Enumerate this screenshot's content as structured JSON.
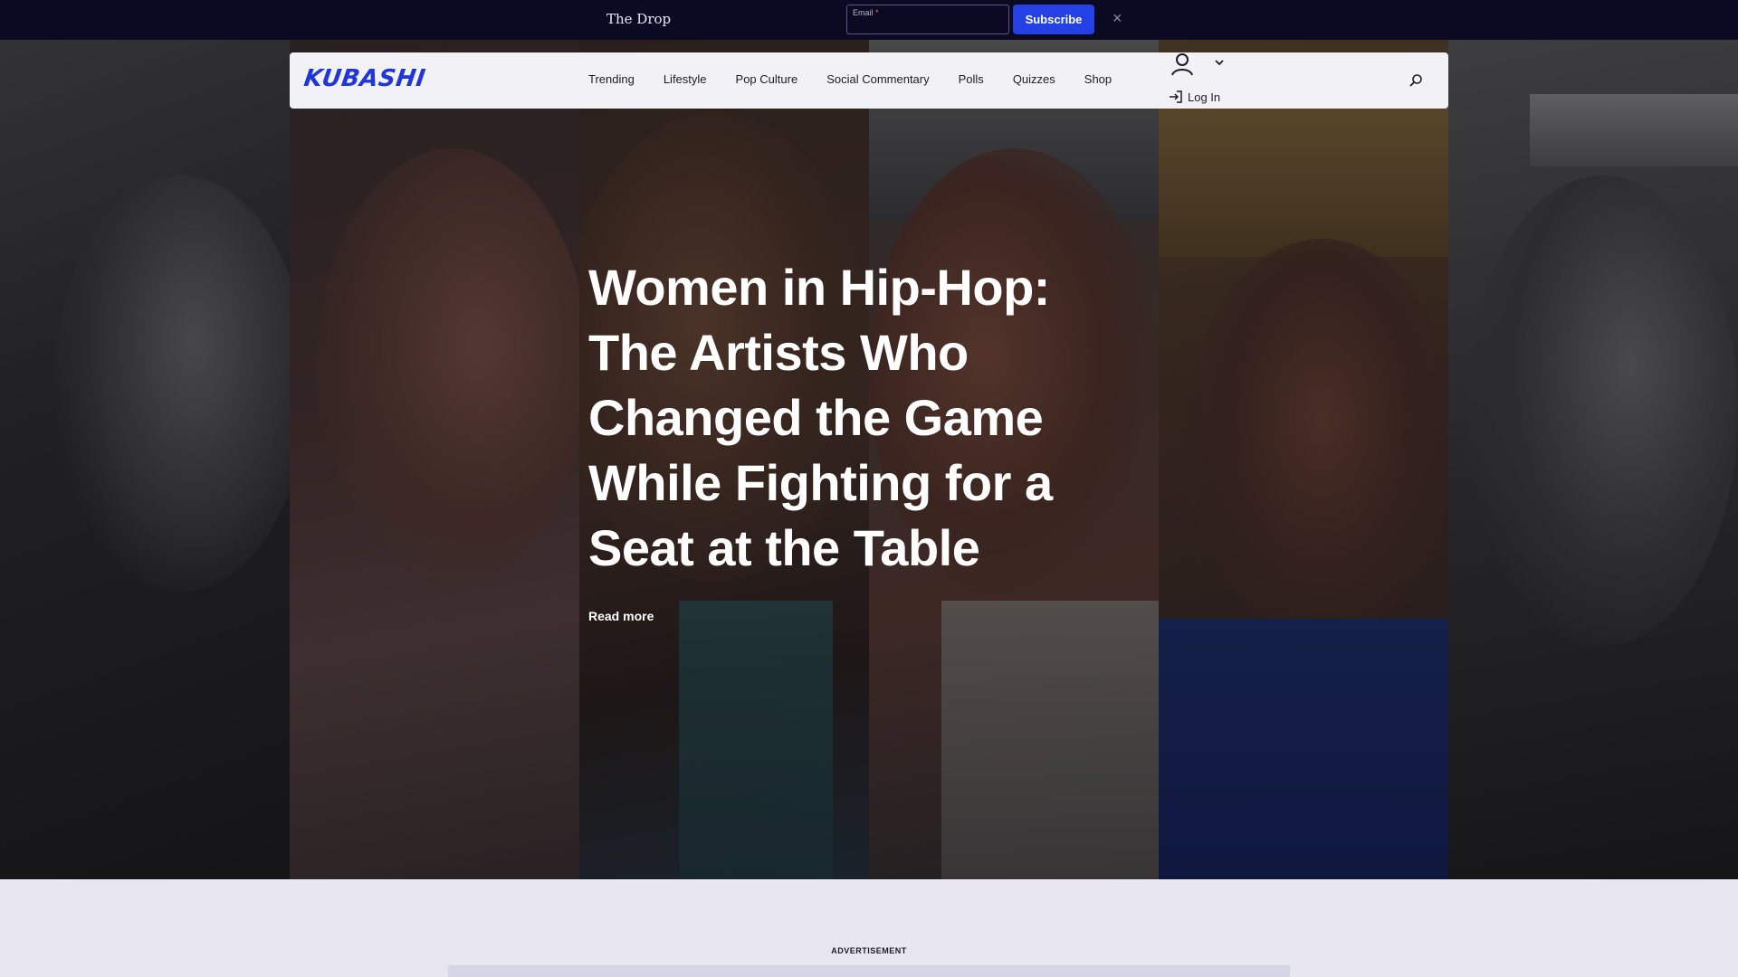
{
  "topbar": {
    "title": "The Drop",
    "email_label": "Email",
    "email_required": "*",
    "email_value": "",
    "subscribe_label": "Subscribe",
    "close_glyph": "×"
  },
  "nav": {
    "logo_text": "KUBASHI",
    "logo_color": "#1f36d8",
    "links": [
      "Trending",
      "Lifestyle",
      "Pop Culture",
      "Social Commentary",
      "Polls",
      "Quizzes",
      "Shop"
    ],
    "login_label": "Log In",
    "icons": [
      "user-icon",
      "chevron-down-icon",
      "login-arrow-icon",
      "search-icon"
    ]
  },
  "hero": {
    "headline": "Women in Hip-Hop: The Artists Who Changed the Game While Fighting for a Seat at the Table",
    "read_more": "Read more"
  },
  "ad": {
    "label": "ADVERTISEMENT"
  },
  "colors": {
    "topbar_bg": "#0b0a22",
    "accent": "#2441e6",
    "page_bg": "#e8e7f1"
  }
}
